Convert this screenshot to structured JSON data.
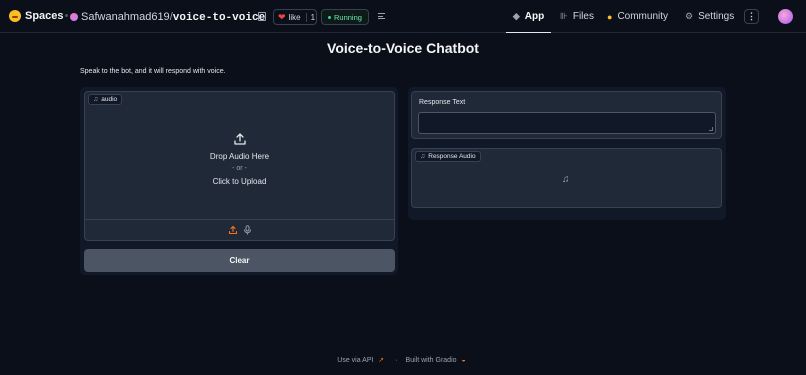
{
  "topbar": {
    "brand": "Spaces",
    "owner": "Safwanahmad619",
    "separator": "/",
    "repo": "voice-to-voice",
    "like_label": "like",
    "like_count": "1",
    "status": "Running",
    "status_color": "#34d399",
    "nav": {
      "app": "App",
      "files": "Files",
      "community": "Community",
      "settings": "Settings"
    },
    "more_label": "⋮"
  },
  "main": {
    "title": "Voice-to-Voice Chatbot",
    "description": "Speak to the bot, and it will respond with voice.",
    "audio_input": {
      "label": "audio",
      "drop_text": "Drop Audio Here",
      "or_text": "- or -",
      "click_text": "Click to Upload"
    },
    "clear_button": "Clear",
    "response_text_label": "Response Text",
    "response_text_value": "",
    "response_audio_label": "Response Audio"
  },
  "footer": {
    "api_link": "Use via API",
    "built_with": "Built with Gradio",
    "separator": "·"
  },
  "colors": {
    "background": "#0b0f19",
    "panel": "#1f2937",
    "clear_button": "#4b5563",
    "upload_accent": "#f97316"
  }
}
